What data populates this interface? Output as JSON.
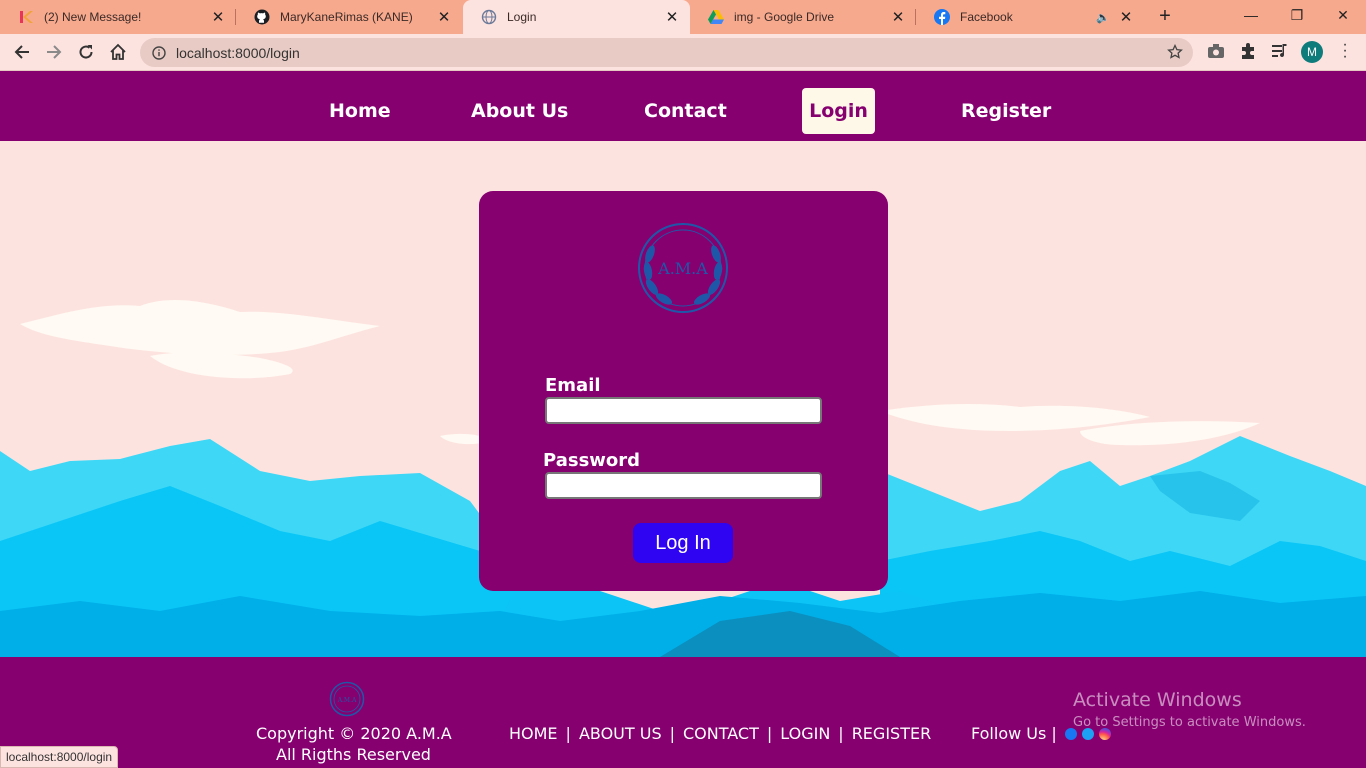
{
  "browser": {
    "tabs": [
      {
        "title": "(2) New Message!",
        "icon": "k-logo-icon"
      },
      {
        "title": "MaryKaneRimas (KANE)",
        "icon": "github-icon"
      },
      {
        "title": "Login",
        "icon": "globe-icon"
      },
      {
        "title": "img - Google Drive",
        "icon": "google-drive-icon"
      },
      {
        "title": "Facebook",
        "icon": "facebook-icon"
      }
    ],
    "active_tab": 2,
    "url": "localhost:8000/login",
    "profile_initial": "M",
    "status_url": "localhost:8000/login"
  },
  "nav": {
    "items": [
      {
        "label": "Home"
      },
      {
        "label": "About Us"
      },
      {
        "label": "Contact"
      },
      {
        "label": "Login"
      },
      {
        "label": "Register"
      }
    ],
    "active": "Login"
  },
  "login": {
    "logo_text": "A.M.A",
    "email_label": "Email",
    "email_value": "",
    "password_label": "Password",
    "password_value": "",
    "submit_label": "Log In"
  },
  "footer": {
    "logo_text": "A.M.A",
    "copyright_line1": "Copyright © 2020 A.M.A",
    "copyright_line2": "All Rigths Reserved",
    "links": [
      "HOME",
      "ABOUT US",
      "CONTACT",
      "LOGIN",
      "REGISTER"
    ],
    "follow_label": "Follow Us |",
    "social_icons": [
      "facebook-icon",
      "twitter-icon",
      "instagram-icon"
    ]
  },
  "watermark": {
    "title": "Activate Windows",
    "subtitle": "Go to Settings to activate Windows."
  },
  "colors": {
    "brand_purple": "#860070",
    "page_bg": "#fde3e0",
    "button_blue": "#2f04f2",
    "tabbar": "#f7a98e",
    "sky_blue": "#3fd4f7",
    "deep_blue": "#00aee8"
  }
}
